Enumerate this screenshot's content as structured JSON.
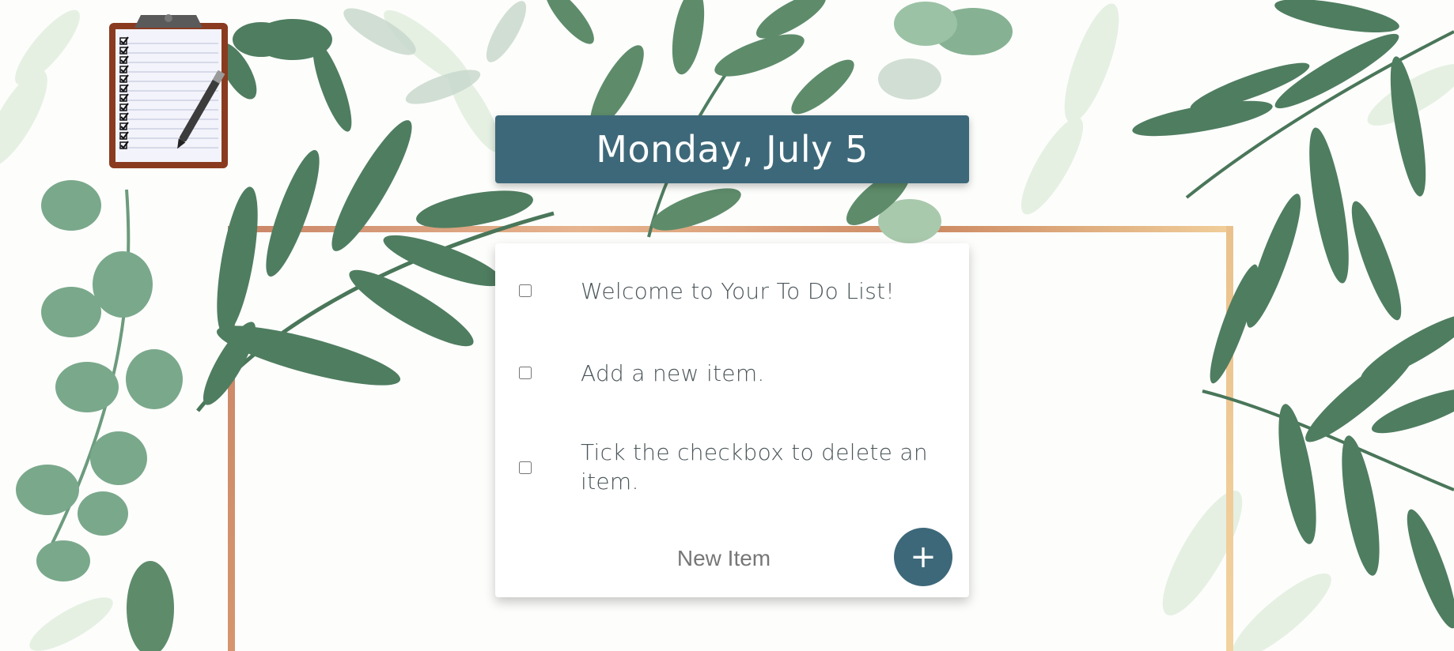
{
  "header": {
    "date_title": "Monday, July 5"
  },
  "todo": {
    "items": [
      {
        "label": "Welcome to Your To Do List!",
        "checked": false
      },
      {
        "label": "Add a new item.",
        "checked": false
      },
      {
        "label": "Tick the checkbox to delete an item.",
        "checked": false
      }
    ],
    "new_item": {
      "placeholder": "New Item",
      "value": ""
    },
    "add_button_label": "+"
  },
  "colors": {
    "accent": "#3d6879",
    "frame_copper": "#c98e6a",
    "leaf_dark": "#4f7d60",
    "leaf_light": "#a9c9ad"
  },
  "icons": {
    "logo": "clipboard-checklist-icon",
    "add": "plus-icon"
  }
}
